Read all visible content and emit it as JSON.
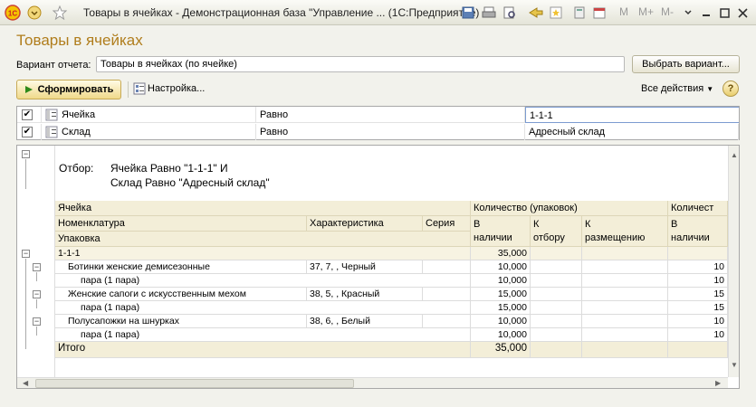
{
  "window": {
    "title": "Товары в ячейках - Демонстрационная база \"Управление ...  (1С:Предприятие)",
    "m": "M",
    "mplus": "M+",
    "mminus": "M-"
  },
  "page": {
    "title": "Товары в ячейках"
  },
  "variant": {
    "label": "Вариант отчета:",
    "value": "Товары в ячейках (по ячейке)",
    "choose_button": "Выбрать вариант..."
  },
  "toolbar": {
    "generate": "Сформировать",
    "settings": "Настройка...",
    "all_actions": "Все действия",
    "help": "?"
  },
  "filters": [
    {
      "checked": true,
      "field": "Ячейка",
      "condition": "Равно",
      "value": "1-1-1"
    },
    {
      "checked": true,
      "field": "Склад",
      "condition": "Равно",
      "value": "Адресный склад"
    }
  ],
  "report": {
    "selection_label": "Отбор:",
    "selection_line1": "Ячейка Равно \"1-1-1\" И",
    "selection_line2": "Склад Равно \"Адресный склад\"",
    "headers": {
      "cell": "Ячейка",
      "nomenclature": "Номенклатура",
      "characteristic": "Характеристика",
      "series": "Серия",
      "package": "Упаковка",
      "qty_packs": "Количество (упаковок)",
      "qty_cut": "Количест",
      "available1": "В",
      "available2": "наличии",
      "to_pick1": "К",
      "to_pick2": "отбору",
      "to_place1": "К",
      "to_place2": "размещению",
      "available_b1": "В",
      "available_b2": "наличии"
    },
    "group_row": {
      "name": "1-1-1",
      "available": "35,000"
    },
    "rows": [
      {
        "name": "Ботинки женские демисезонные",
        "char": "37, 7, , Черный",
        "available": "10,000",
        "extra": "10",
        "pack": "пара (1 пара)",
        "pack_available": "10,000",
        "pack_extra": "10"
      },
      {
        "name": "Женские сапоги с искусственным мехом",
        "char": "38, 5, , Красный",
        "available": "15,000",
        "extra": "15",
        "pack": "пара (1 пара)",
        "pack_available": "15,000",
        "pack_extra": "15"
      },
      {
        "name": "Полусапожки на шнурках",
        "char": "38, 6, , Белый",
        "available": "10,000",
        "extra": "10",
        "pack": "пара (1 пара)",
        "pack_available": "10,000",
        "pack_extra": "10"
      }
    ],
    "total": {
      "label": "Итого",
      "available": "35,000"
    }
  }
}
